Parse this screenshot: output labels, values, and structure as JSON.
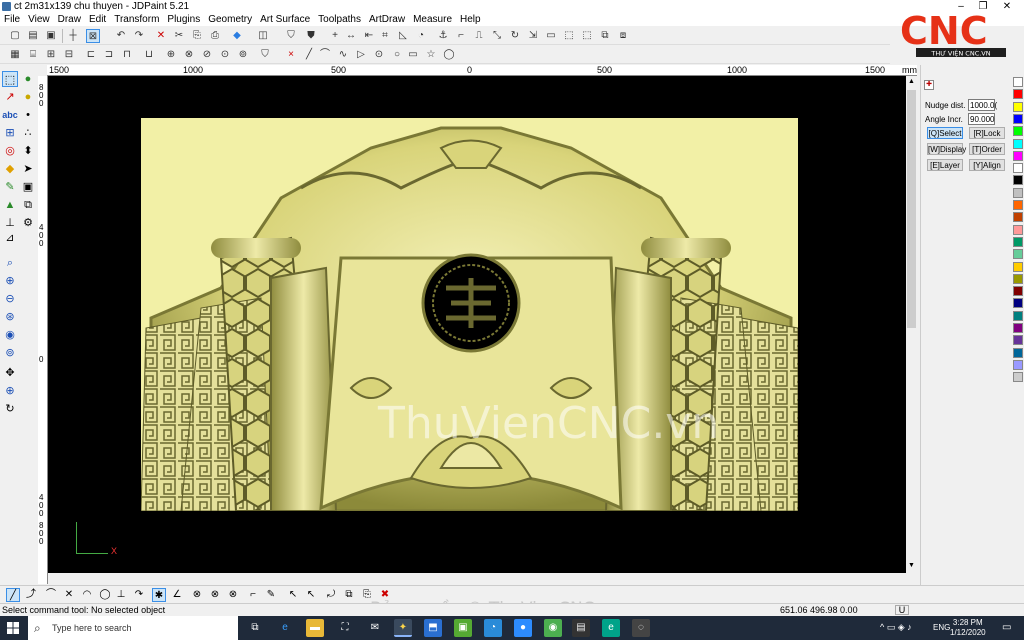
{
  "window": {
    "title": "ct 2m31x139 chu thuyen - JDPaint 5.21"
  },
  "menu": [
    "File",
    "View",
    "Draw",
    "Edit",
    "Transform",
    "Plugins",
    "Geometry",
    "Art Surface",
    "Toolpaths",
    "ArtDraw",
    "Measure",
    "Help"
  ],
  "ruler": {
    "top_labels": [
      "1500",
      "1000",
      "500",
      "0",
      "500",
      "1000",
      "1500",
      "mm"
    ],
    "left_labels": [
      "8",
      "0",
      "0",
      "4",
      "0",
      "0",
      "0",
      "4",
      "0",
      "0",
      "8",
      "0",
      "0"
    ]
  },
  "right_panel": {
    "nudge_label": "Nudge dist.",
    "nudge_value": "1000.0(",
    "angle_label": "Angle Incr.",
    "angle_value": "90.000",
    "buttons": [
      "[Q]Select",
      "[R]Lock",
      "[W]Display",
      "[T]Order",
      "[E]Layer",
      "[Y]Align"
    ]
  },
  "palette": [
    "#ffffff",
    "#ff0000",
    "#ffff00",
    "#0000ff",
    "#00ff00",
    "#00ffff",
    "#ff00ff",
    "#ffffff",
    "#000000",
    "#c0c0c0",
    "#ff6600",
    "#c04000",
    "#ff9999",
    "#009966",
    "#66cc99",
    "#ffcc00",
    "#999900",
    "#800000",
    "#000080",
    "#008080",
    "#800080",
    "#663399",
    "#006699",
    "#9999ff",
    "#cccccc"
  ],
  "canvas": {
    "watermark": "ThuVienCNC.vn"
  },
  "logo": {
    "brand": "CNC",
    "tagline": "THƯ VIỆN CNC.VN"
  },
  "status": {
    "message": "Select command tool: No selected object",
    "coords": "651.06 496.98 0.00",
    "unit": "U"
  },
  "bottom_watermark": "Bản quyền © ThuVienCNC.vn",
  "taskbar": {
    "search_placeholder": "Type here to search",
    "language": "ENG",
    "time": "3:28 PM",
    "date": "1/12/2020"
  },
  "axis_label": "X"
}
